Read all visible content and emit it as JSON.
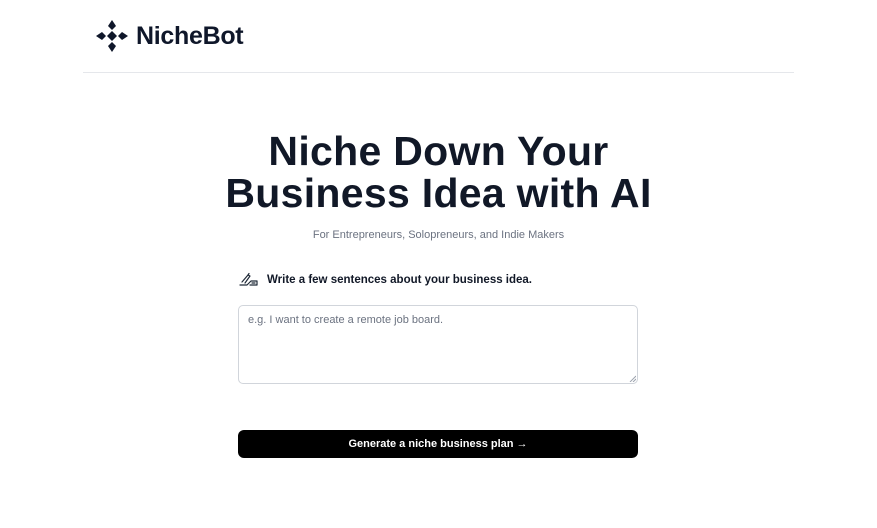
{
  "header": {
    "brand": "NicheBot",
    "logo_icon": "nichebot-logo-icon"
  },
  "hero": {
    "title_line1": "Niche Down Your",
    "title_line2": "Business Idea with AI",
    "subtitle": "For Entrepreneurs, Solopreneurs, and Indie Makers"
  },
  "form": {
    "prompt_icon": "writing-hand-icon",
    "prompt_label": "Write a few sentences about your business idea.",
    "idea_value": "",
    "idea_placeholder": "e.g. I want to create a remote job board.",
    "submit_label": "Generate a niche business plan →"
  },
  "colors": {
    "text_dark": "#111827",
    "subtitle_gray": "#6b7280",
    "button_bg": "#000000",
    "border": "#d1d5db"
  }
}
